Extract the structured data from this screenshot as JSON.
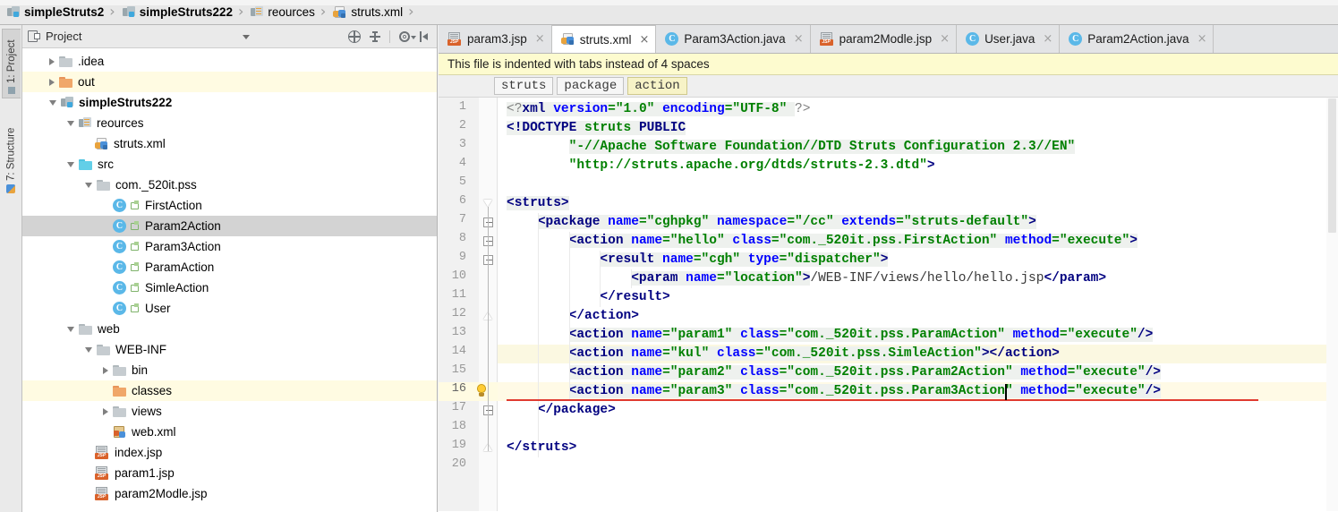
{
  "breadcrumb": {
    "items": [
      {
        "label": "simpleStruts2",
        "icon": "module-icon",
        "bold": true
      },
      {
        "label": "simpleStruts222",
        "icon": "module-icon",
        "bold": true
      },
      {
        "label": "reources",
        "icon": "resources-folder-icon",
        "bold": false
      },
      {
        "label": "struts.xml",
        "icon": "xml-file-icon",
        "bold": false
      }
    ],
    "separator": "›"
  },
  "tool_tabs": [
    {
      "label": "1: Project",
      "icon": "project-icon",
      "active": true
    },
    {
      "label": "7: Structure",
      "icon": "structure-icon",
      "active": false
    }
  ],
  "project_panel": {
    "title": "Project",
    "title_icon": "project-view-icon",
    "dropdown_icon": "chevron-down-icon",
    "toolbar_icons": [
      "collapse-all-icon",
      "expand-all-icon",
      "settings-gear-icon",
      "hide-panel-icon"
    ],
    "tree": [
      {
        "label": ".idea",
        "indent": 1,
        "arrow": "right",
        "icon": "folder-gray",
        "style": "normal"
      },
      {
        "label": "out",
        "indent": 1,
        "arrow": "right",
        "icon": "folder-orange",
        "style": "highlight"
      },
      {
        "label": "simpleStruts222",
        "indent": 1,
        "arrow": "down",
        "icon": "module-icon",
        "style": "bold"
      },
      {
        "label": "reources",
        "indent": 2,
        "arrow": "down",
        "icon": "resources-folder-icon",
        "style": "normal"
      },
      {
        "label": "struts.xml",
        "indent": 3,
        "arrow": "none",
        "icon": "xml-file-icon",
        "style": "normal"
      },
      {
        "label": "src",
        "indent": 2,
        "arrow": "down",
        "icon": "folder-blue",
        "style": "normal"
      },
      {
        "label": "com._520it.pss",
        "indent": 3,
        "arrow": "down",
        "icon": "folder-gray",
        "style": "normal"
      },
      {
        "label": "FirstAction",
        "indent": 4,
        "arrow": "none",
        "icon": "java-class-icon",
        "style": "normal"
      },
      {
        "label": "Param2Action",
        "indent": 4,
        "arrow": "none",
        "icon": "java-class-icon",
        "style": "selected"
      },
      {
        "label": "Param3Action",
        "indent": 4,
        "arrow": "none",
        "icon": "java-class-icon",
        "style": "normal"
      },
      {
        "label": "ParamAction",
        "indent": 4,
        "arrow": "none",
        "icon": "java-class-icon",
        "style": "normal"
      },
      {
        "label": "SimleAction",
        "indent": 4,
        "arrow": "none",
        "icon": "java-class-icon",
        "style": "normal"
      },
      {
        "label": "User",
        "indent": 4,
        "arrow": "none",
        "icon": "java-class-icon",
        "style": "normal"
      },
      {
        "label": "web",
        "indent": 2,
        "arrow": "down",
        "icon": "folder-gray",
        "style": "normal"
      },
      {
        "label": "WEB-INF",
        "indent": 3,
        "arrow": "down",
        "icon": "folder-gray",
        "style": "normal"
      },
      {
        "label": "bin",
        "indent": 4,
        "arrow": "right",
        "icon": "folder-gray",
        "style": "normal"
      },
      {
        "label": "classes",
        "indent": 4,
        "arrow": "none",
        "icon": "folder-orange",
        "style": "highlight"
      },
      {
        "label": "views",
        "indent": 4,
        "arrow": "right",
        "icon": "folder-gray",
        "style": "normal"
      },
      {
        "label": "web.xml",
        "indent": 4,
        "arrow": "none",
        "icon": "webxml-file-icon",
        "style": "normal"
      },
      {
        "label": "index.jsp",
        "indent": 3,
        "arrow": "none",
        "icon": "jsp-file-icon",
        "style": "normal"
      },
      {
        "label": "param1.jsp",
        "indent": 3,
        "arrow": "none",
        "icon": "jsp-file-icon",
        "style": "normal"
      },
      {
        "label": "param2Modle.jsp",
        "indent": 3,
        "arrow": "none",
        "icon": "jsp-file-icon",
        "style": "normal"
      }
    ]
  },
  "editor_tabs": [
    {
      "label": "param3.jsp",
      "icon": "jsp-file-icon",
      "active": false,
      "close": "×"
    },
    {
      "label": "struts.xml",
      "icon": "xml-file-icon",
      "active": true,
      "close": "×"
    },
    {
      "label": "Param3Action.java",
      "icon": "java-class-icon",
      "active": false,
      "close": "×"
    },
    {
      "label": "param2Modle.jsp",
      "icon": "jsp-file-icon",
      "active": false,
      "close": "×"
    },
    {
      "label": "User.java",
      "icon": "java-class-icon",
      "active": false,
      "close": "×"
    },
    {
      "label": "Param2Action.java",
      "icon": "java-class-icon",
      "active": false,
      "close": "×"
    }
  ],
  "banner": {
    "text": "This file is indented with tabs instead of 4 spaces"
  },
  "xml_breadcrumbs": [
    {
      "label": "struts",
      "highlight": false
    },
    {
      "label": "package",
      "highlight": false
    },
    {
      "label": "action",
      "highlight": true
    }
  ],
  "editor": {
    "line_numbers": [
      1,
      2,
      3,
      4,
      5,
      6,
      7,
      8,
      9,
      10,
      11,
      12,
      13,
      14,
      15,
      16,
      17,
      18,
      19,
      20
    ],
    "caret_line": 16,
    "warning_line": 14,
    "bulb_line": 16,
    "error_underline_line": 16,
    "lines": [
      {
        "n": 1,
        "text": "<?xml version=\"1.0\" encoding=\"UTF-8\" ?>"
      },
      {
        "n": 2,
        "text": "<!DOCTYPE struts PUBLIC"
      },
      {
        "n": 3,
        "text": "        \"-//Apache Software Foundation//DTD Struts Configuration 2.3//EN\""
      },
      {
        "n": 4,
        "text": "        \"http://struts.apache.org/dtds/struts-2.3.dtd\">"
      },
      {
        "n": 5,
        "text": ""
      },
      {
        "n": 6,
        "text": "<struts>"
      },
      {
        "n": 7,
        "text": "    <package name=\"cghpkg\" namespace=\"/cc\" extends=\"struts-default\">"
      },
      {
        "n": 8,
        "text": "        <action name=\"hello\" class=\"com._520it.pss.FirstAction\" method=\"execute\">"
      },
      {
        "n": 9,
        "text": "            <result name=\"cgh\" type=\"dispatcher\">"
      },
      {
        "n": 10,
        "text": "                <param name=\"location\">/WEB-INF/views/hello/hello.jsp</param>"
      },
      {
        "n": 11,
        "text": "            </result>"
      },
      {
        "n": 12,
        "text": "        </action>"
      },
      {
        "n": 13,
        "text": "        <action name=\"param1\" class=\"com._520it.pss.ParamAction\" method=\"execute\"/>"
      },
      {
        "n": 14,
        "text": "        <action name=\"kul\" class=\"com._520it.pss.SimleAction\"></action>"
      },
      {
        "n": 15,
        "text": "        <action name=\"param2\" class=\"com._520it.pss.Param2Action\" method=\"execute\"/>"
      },
      {
        "n": 16,
        "text": "        <action name=\"param3\" class=\"com._520it.pss.Param3Action\" method=\"execute\"/>"
      },
      {
        "n": 17,
        "text": "    </package>"
      },
      {
        "n": 18,
        "text": ""
      },
      {
        "n": 19,
        "text": "</struts>"
      },
      {
        "n": 20,
        "text": ""
      }
    ]
  },
  "colors": {
    "tag": "#000080",
    "attribute": "#0000ff",
    "value": "#008000",
    "warning_row": "#fbf8e1",
    "caret_row": "#fffae6",
    "error": "#e03b30",
    "banner_bg": "#fdfbcf",
    "selection": "#d3d3d3"
  }
}
